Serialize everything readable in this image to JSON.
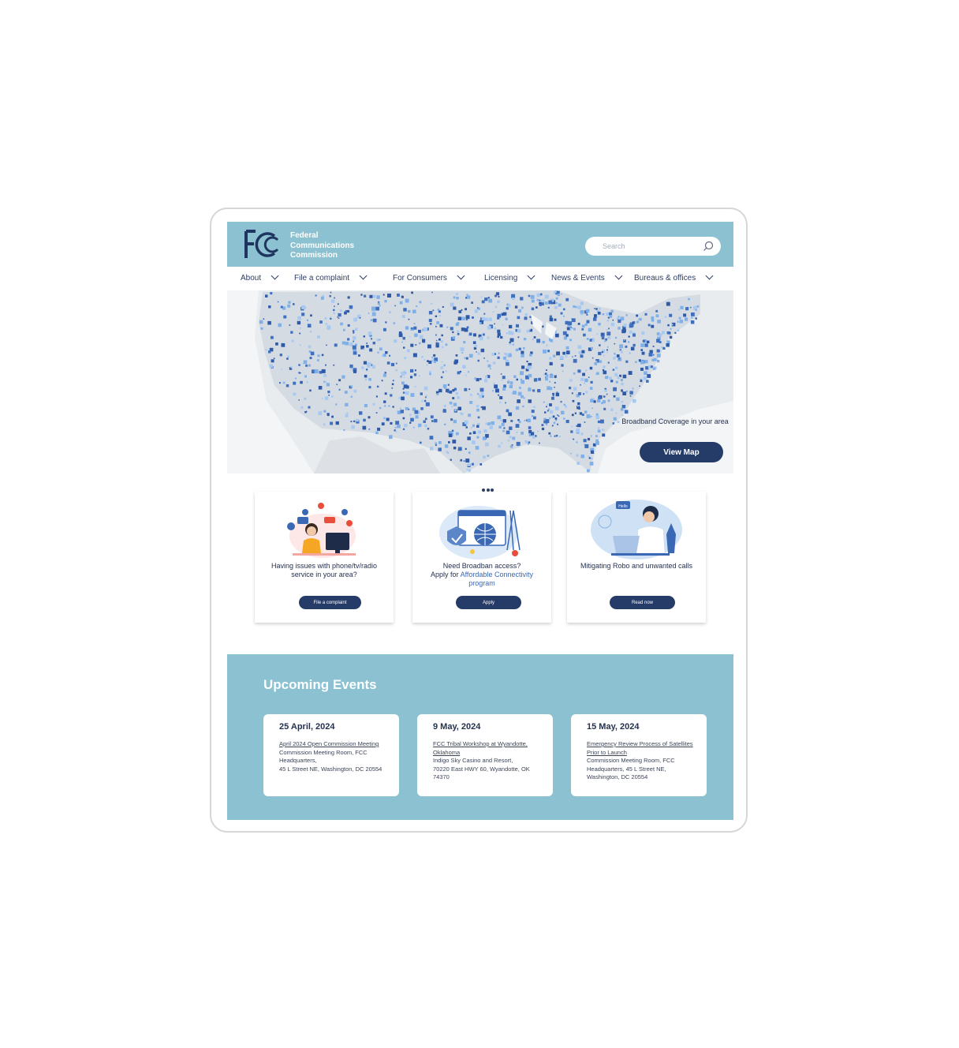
{
  "header": {
    "logo_mark": "FCC",
    "org_name_line1": "Federal",
    "org_name_line2": "Communications",
    "org_name_line3": "Commission",
    "search_placeholder": "Search"
  },
  "nav": {
    "items": [
      {
        "label": "About"
      },
      {
        "label": "File a complaint"
      },
      {
        "label": "For Consumers"
      },
      {
        "label": "Licensing"
      },
      {
        "label": "News & Events"
      },
      {
        "label": "Bureaus & offices"
      }
    ]
  },
  "hero": {
    "caption": "Broadband Coverage in your area",
    "button_label": "View Map"
  },
  "cards": [
    {
      "text": "Having issues with phone/tv/radio service in your area?",
      "button_label": "File a complaint"
    },
    {
      "text_prefix": "Need Broadban access?",
      "text_apply": "Apply for",
      "link_text": "Affordable Connectivity program",
      "button_label": "Apply"
    },
    {
      "text": "Mitigating Robo and unwanted calls",
      "button_label": "Read now",
      "bubble_text": "Hello"
    }
  ],
  "events": {
    "title": "Upcoming Events",
    "items": [
      {
        "date": "25 April, 2024",
        "link": "April 2024 Open Commission Meeting",
        "line1": "Commission Meeting Room, FCC Headquarters,",
        "line2": "45 L Street NE, Washington, DC 20554"
      },
      {
        "date": "9 May, 2024",
        "link": "FCC Tribal Workshop at Wyandotte, Oklahoma",
        "line1": "Indigo Sky Casino and Resort,",
        "line2": "70220 East HWY 60, Wyandotte, OK 74370"
      },
      {
        "date": "15 May, 2024",
        "link": "Emergency Review Process of Satellites Prior to Launch",
        "line1": "Commission Meeting Room, FCC Headquarters, 45 L Street NE,",
        "line2": "Washington, DC 20554"
      }
    ]
  },
  "colors": {
    "brand_teal": "#8bc1d0",
    "navy": "#263c68",
    "map_blue": "#3f6fbf",
    "map_light": "#7fb0e8"
  }
}
